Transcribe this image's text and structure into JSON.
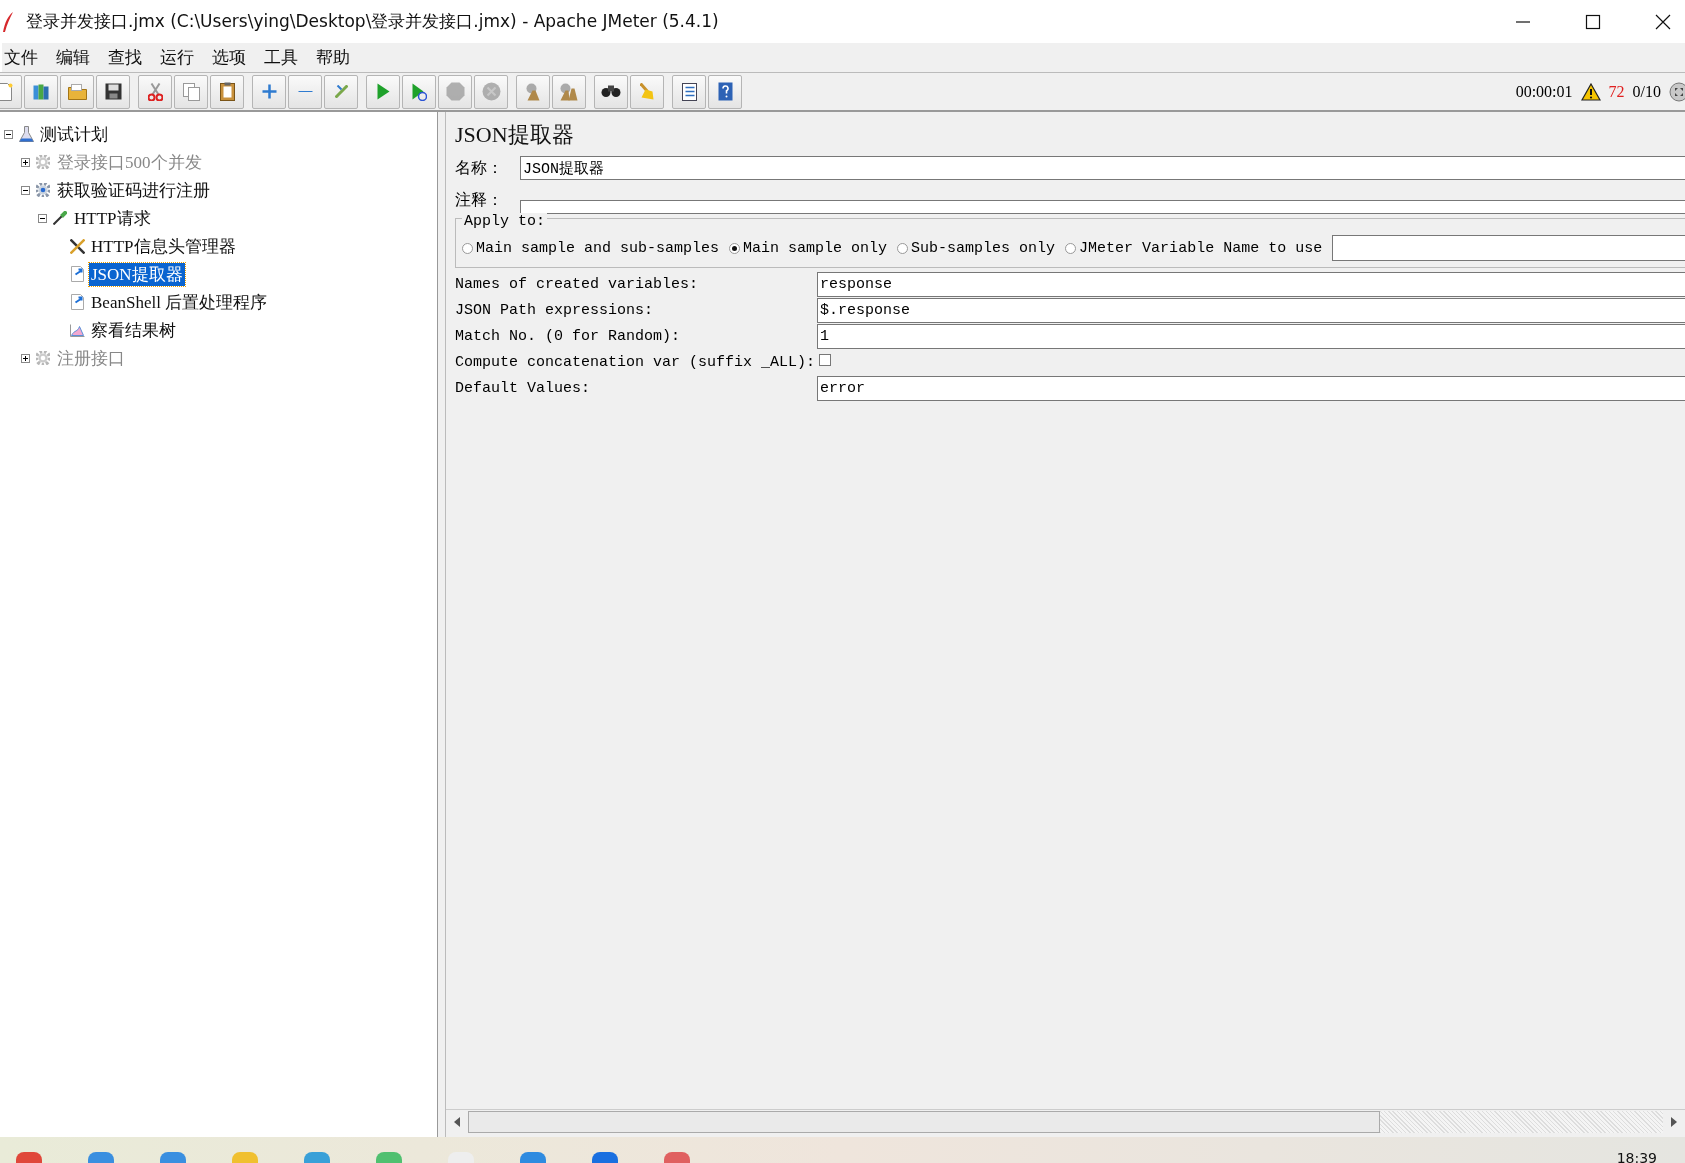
{
  "window": {
    "title": "登录并发接口.jmx (C:\\Users\\ying\\Desktop\\登录并发接口.jmx) - Apache JMeter (5.4.1)"
  },
  "menu": [
    "文件",
    "编辑",
    "查找",
    "运行",
    "选项",
    "工具",
    "帮助"
  ],
  "toolbar": {
    "groups": [
      [
        {
          "kind": "new",
          "disabled": false
        },
        {
          "kind": "templates",
          "disabled": false
        },
        {
          "kind": "open",
          "disabled": false
        },
        {
          "kind": "save",
          "disabled": false
        }
      ],
      [
        {
          "kind": "cut",
          "disabled": false
        },
        {
          "kind": "copy",
          "disabled": false
        },
        {
          "kind": "paste",
          "disabled": false
        }
      ],
      [
        {
          "kind": "expand",
          "disabled": false
        },
        {
          "kind": "collapse",
          "disabled": false
        },
        {
          "kind": "toggle",
          "disabled": false
        }
      ],
      [
        {
          "kind": "start",
          "disabled": false
        },
        {
          "kind": "start-no-pause",
          "disabled": false
        },
        {
          "kind": "stop",
          "disabled": true
        },
        {
          "kind": "shutdown",
          "disabled": true
        }
      ],
      [
        {
          "kind": "clear",
          "disabled": false
        },
        {
          "kind": "clear-all",
          "disabled": false
        }
      ],
      [
        {
          "kind": "search",
          "disabled": false
        },
        {
          "kind": "reset-search",
          "disabled": false
        }
      ],
      [
        {
          "kind": "function-helper",
          "disabled": false
        },
        {
          "kind": "help",
          "disabled": false
        }
      ]
    ],
    "elapsed": "00:00:01",
    "warnings": "72",
    "threads": "0/10"
  },
  "tree": [
    {
      "label": "测试计划",
      "kind": "plan",
      "expanded": true,
      "disabled": false,
      "selected": false,
      "children": [
        {
          "label": "登录接口500个并发",
          "kind": "thread-group",
          "expanded": false,
          "disabled": true,
          "selected": false
        },
        {
          "label": "获取验证码进行注册",
          "kind": "thread-group",
          "expanded": true,
          "disabled": false,
          "selected": false,
          "children": [
            {
              "label": "HTTP请求",
              "kind": "sampler",
              "expanded": true,
              "disabled": false,
              "selected": false,
              "children": [
                {
                  "label": "HTTP信息头管理器",
                  "kind": "config",
                  "disabled": false,
                  "selected": false
                },
                {
                  "label": "JSON提取器",
                  "kind": "extractor",
                  "disabled": false,
                  "selected": true
                },
                {
                  "label": "BeanShell 后置处理程序",
                  "kind": "extractor",
                  "disabled": false,
                  "selected": false
                },
                {
                  "label": "察看结果树",
                  "kind": "listener",
                  "disabled": false,
                  "selected": false
                }
              ]
            }
          ]
        },
        {
          "label": "注册接口",
          "kind": "thread-group",
          "expanded": false,
          "disabled": true,
          "selected": false
        }
      ]
    }
  ],
  "panel": {
    "title": "JSON提取器",
    "name_label": "名称：",
    "name_value": "JSON提取器",
    "comment_label": "注释：",
    "apply_to": {
      "legend": "Apply to:",
      "options": [
        {
          "label": "Main sample and sub-samples",
          "selected": false
        },
        {
          "label": "Main sample only",
          "selected": true
        },
        {
          "label": "Sub-samples only",
          "selected": false
        },
        {
          "label": "JMeter Variable Name to use",
          "selected": false
        }
      ]
    },
    "fields": [
      {
        "kind": "text",
        "label": "Names of created variables:",
        "value": "response"
      },
      {
        "kind": "text",
        "label": "JSON Path expressions:",
        "value": "$.response"
      },
      {
        "kind": "text",
        "label": "Match No. (0 for Random):",
        "value": "1"
      },
      {
        "kind": "checkbox",
        "label": "Compute concatenation var (suffix _ALL):",
        "checked": false
      },
      {
        "kind": "text",
        "label": "Default Values:",
        "value": "error"
      }
    ]
  },
  "taskbar": {
    "clock": "18:39"
  }
}
